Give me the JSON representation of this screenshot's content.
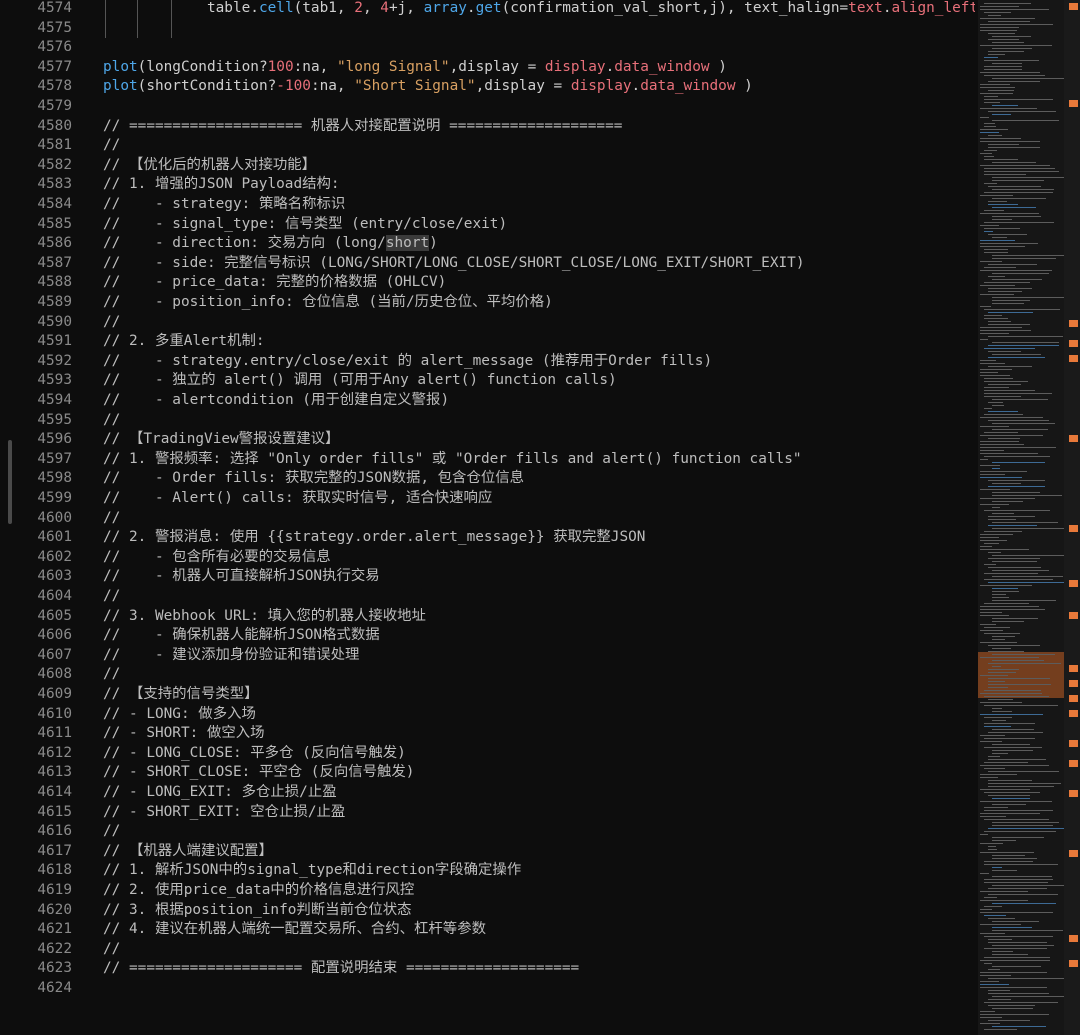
{
  "editor": {
    "lines": [
      {
        "n": "4574",
        "tokens": [
          {
            "t": "            table.",
            "c": "plain"
          },
          {
            "t": "cell",
            "c": "kw"
          },
          {
            "t": "(tab1, ",
            "c": "plain"
          },
          {
            "t": "2",
            "c": "num"
          },
          {
            "t": ", ",
            "c": "plain"
          },
          {
            "t": "4",
            "c": "num"
          },
          {
            "t": "+j, ",
            "c": "plain"
          },
          {
            "t": "array",
            "c": "kw"
          },
          {
            "t": ".",
            "c": "plain"
          },
          {
            "t": "get",
            "c": "kw"
          },
          {
            "t": "(confirmation_val_short,j), text_halign=",
            "c": "plain"
          },
          {
            "t": "text",
            "c": "num"
          },
          {
            "t": ".",
            "c": "plain"
          },
          {
            "t": "align_left",
            "c": "num"
          },
          {
            "t": ",",
            "c": "plain"
          }
        ]
      },
      {
        "n": "4575",
        "tokens": []
      },
      {
        "n": "4576",
        "tokens": []
      },
      {
        "n": "4577",
        "tokens": [
          {
            "t": "plot",
            "c": "kw"
          },
          {
            "t": "(longCondition?",
            "c": "plain"
          },
          {
            "t": "100",
            "c": "num"
          },
          {
            "t": ":na, ",
            "c": "plain"
          },
          {
            "t": "\"long Signal\"",
            "c": "str"
          },
          {
            "t": ",display = ",
            "c": "plain"
          },
          {
            "t": "display",
            "c": "num"
          },
          {
            "t": ".",
            "c": "plain"
          },
          {
            "t": "data_window",
            "c": "num"
          },
          {
            "t": " )",
            "c": "plain"
          }
        ]
      },
      {
        "n": "4578",
        "tokens": [
          {
            "t": "plot",
            "c": "kw"
          },
          {
            "t": "(shortCondition?",
            "c": "plain"
          },
          {
            "t": "-100",
            "c": "num"
          },
          {
            "t": ":na, ",
            "c": "plain"
          },
          {
            "t": "\"Short Signal\"",
            "c": "str"
          },
          {
            "t": ",display = ",
            "c": "plain"
          },
          {
            "t": "display",
            "c": "num"
          },
          {
            "t": ".",
            "c": "plain"
          },
          {
            "t": "data_window",
            "c": "num"
          },
          {
            "t": " )",
            "c": "plain"
          }
        ]
      },
      {
        "n": "4579",
        "tokens": []
      },
      {
        "n": "4580",
        "tokens": [
          {
            "t": "// ==================== 机器人对接配置说明 ====================",
            "c": "cmt"
          }
        ]
      },
      {
        "n": "4581",
        "tokens": [
          {
            "t": "//",
            "c": "cmt"
          }
        ]
      },
      {
        "n": "4582",
        "tokens": [
          {
            "t": "// 【优化后的机器人对接功能】",
            "c": "cmt"
          }
        ]
      },
      {
        "n": "4583",
        "tokens": [
          {
            "t": "// 1. 增强的JSON Payload结构:",
            "c": "cmt"
          }
        ]
      },
      {
        "n": "4584",
        "tokens": [
          {
            "t": "//    - strategy: 策略名称标识",
            "c": "cmt"
          }
        ]
      },
      {
        "n": "4585",
        "tokens": [
          {
            "t": "//    - signal_type: 信号类型 (entry/close/exit)",
            "c": "cmt"
          }
        ]
      },
      {
        "n": "4586",
        "tokens": [
          {
            "t": "//    - direction: 交易方向 (long/",
            "c": "cmt"
          },
          {
            "t": "short",
            "c": "cmt",
            "hl": true
          },
          {
            "t": ")",
            "c": "cmt"
          }
        ]
      },
      {
        "n": "4587",
        "tokens": [
          {
            "t": "//    - side: 完整信号标识 (LONG/SHORT/LONG_CLOSE/SHORT_CLOSE/LONG_EXIT/SHORT_EXIT)",
            "c": "cmt"
          }
        ]
      },
      {
        "n": "4588",
        "tokens": [
          {
            "t": "//    - price_data: 完整的价格数据 (OHLCV)",
            "c": "cmt"
          }
        ]
      },
      {
        "n": "4589",
        "tokens": [
          {
            "t": "//    - position_info: 仓位信息 (当前/历史仓位、平均价格)",
            "c": "cmt"
          }
        ]
      },
      {
        "n": "4590",
        "tokens": [
          {
            "t": "//",
            "c": "cmt"
          }
        ]
      },
      {
        "n": "4591",
        "tokens": [
          {
            "t": "// 2. 多重Alert机制:",
            "c": "cmt"
          }
        ]
      },
      {
        "n": "4592",
        "tokens": [
          {
            "t": "//    - strategy.entry/close/exit 的 alert_message (推荐用于Order fills)",
            "c": "cmt"
          }
        ]
      },
      {
        "n": "4593",
        "tokens": [
          {
            "t": "//    - 独立的 alert() 调用 (可用于Any alert() function calls)",
            "c": "cmt"
          }
        ]
      },
      {
        "n": "4594",
        "tokens": [
          {
            "t": "//    - alertcondition (用于创建自定义警报)",
            "c": "cmt"
          }
        ]
      },
      {
        "n": "4595",
        "tokens": [
          {
            "t": "//",
            "c": "cmt"
          }
        ]
      },
      {
        "n": "4596",
        "tokens": [
          {
            "t": "// 【TradingView警报设置建议】",
            "c": "cmt"
          }
        ]
      },
      {
        "n": "4597",
        "tokens": [
          {
            "t": "// 1. 警报频率: 选择 \"Only order fills\" 或 \"Order fills and alert() function calls\"",
            "c": "cmt"
          }
        ]
      },
      {
        "n": "4598",
        "tokens": [
          {
            "t": "//    - Order fills: 获取完整的JSON数据, 包含仓位信息",
            "c": "cmt"
          }
        ]
      },
      {
        "n": "4599",
        "tokens": [
          {
            "t": "//    - Alert() calls: 获取实时信号, 适合快速响应",
            "c": "cmt"
          }
        ]
      },
      {
        "n": "4600",
        "tokens": [
          {
            "t": "//",
            "c": "cmt"
          }
        ]
      },
      {
        "n": "4601",
        "tokens": [
          {
            "t": "// 2. 警报消息: 使用 {{strategy.order.alert_message}} 获取完整JSON",
            "c": "cmt"
          }
        ]
      },
      {
        "n": "4602",
        "tokens": [
          {
            "t": "//    - 包含所有必要的交易信息",
            "c": "cmt"
          }
        ]
      },
      {
        "n": "4603",
        "tokens": [
          {
            "t": "//    - 机器人可直接解析JSON执行交易",
            "c": "cmt"
          }
        ]
      },
      {
        "n": "4604",
        "tokens": [
          {
            "t": "//",
            "c": "cmt"
          }
        ]
      },
      {
        "n": "4605",
        "tokens": [
          {
            "t": "// 3. Webhook URL: 填入您的机器人接收地址",
            "c": "cmt"
          }
        ]
      },
      {
        "n": "4606",
        "tokens": [
          {
            "t": "//    - 确保机器人能解析JSON格式数据",
            "c": "cmt"
          }
        ]
      },
      {
        "n": "4607",
        "tokens": [
          {
            "t": "//    - 建议添加身份验证和错误处理",
            "c": "cmt"
          }
        ]
      },
      {
        "n": "4608",
        "tokens": [
          {
            "t": "//",
            "c": "cmt"
          }
        ]
      },
      {
        "n": "4609",
        "tokens": [
          {
            "t": "// 【支持的信号类型】",
            "c": "cmt"
          }
        ]
      },
      {
        "n": "4610",
        "tokens": [
          {
            "t": "// - LONG: 做多入场",
            "c": "cmt"
          }
        ]
      },
      {
        "n": "4611",
        "tokens": [
          {
            "t": "// - SHORT: 做空入场",
            "c": "cmt"
          }
        ]
      },
      {
        "n": "4612",
        "tokens": [
          {
            "t": "// - LONG_CLOSE: 平多仓 (反向信号触发)",
            "c": "cmt"
          }
        ]
      },
      {
        "n": "4613",
        "tokens": [
          {
            "t": "// - SHORT_CLOSE: 平空仓 (反向信号触发)",
            "c": "cmt"
          }
        ]
      },
      {
        "n": "4614",
        "tokens": [
          {
            "t": "// - LONG_EXIT: 多仓止损/止盈",
            "c": "cmt"
          }
        ]
      },
      {
        "n": "4615",
        "tokens": [
          {
            "t": "// - SHORT_EXIT: 空仓止损/止盈",
            "c": "cmt"
          }
        ]
      },
      {
        "n": "4616",
        "tokens": [
          {
            "t": "//",
            "c": "cmt"
          }
        ]
      },
      {
        "n": "4617",
        "tokens": [
          {
            "t": "// 【机器人端建议配置】",
            "c": "cmt"
          }
        ]
      },
      {
        "n": "4618",
        "tokens": [
          {
            "t": "// 1. 解析JSON中的signal_type和direction字段确定操作",
            "c": "cmt"
          }
        ]
      },
      {
        "n": "4619",
        "tokens": [
          {
            "t": "// 2. 使用price_data中的价格信息进行风控",
            "c": "cmt"
          }
        ]
      },
      {
        "n": "4620",
        "tokens": [
          {
            "t": "// 3. 根据position_info判断当前仓位状态",
            "c": "cmt"
          }
        ]
      },
      {
        "n": "4621",
        "tokens": [
          {
            "t": "// 4. 建议在机器人端统一配置交易所、合约、杠杆等参数",
            "c": "cmt"
          }
        ]
      },
      {
        "n": "4622",
        "tokens": [
          {
            "t": "//",
            "c": "cmt"
          }
        ]
      },
      {
        "n": "4623",
        "tokens": [
          {
            "t": "// ==================== 配置说明结束 ====================",
            "c": "cmt"
          }
        ]
      },
      {
        "n": "4624",
        "tokens": []
      }
    ]
  },
  "colors": {
    "background": "#0d0d0d",
    "keyword": "#4ea6e8",
    "number": "#e8707a",
    "string": "#d8a062",
    "comment": "#bdbdbd",
    "line_number": "#8a8a8a",
    "scroll_marker": "#e8793a"
  }
}
